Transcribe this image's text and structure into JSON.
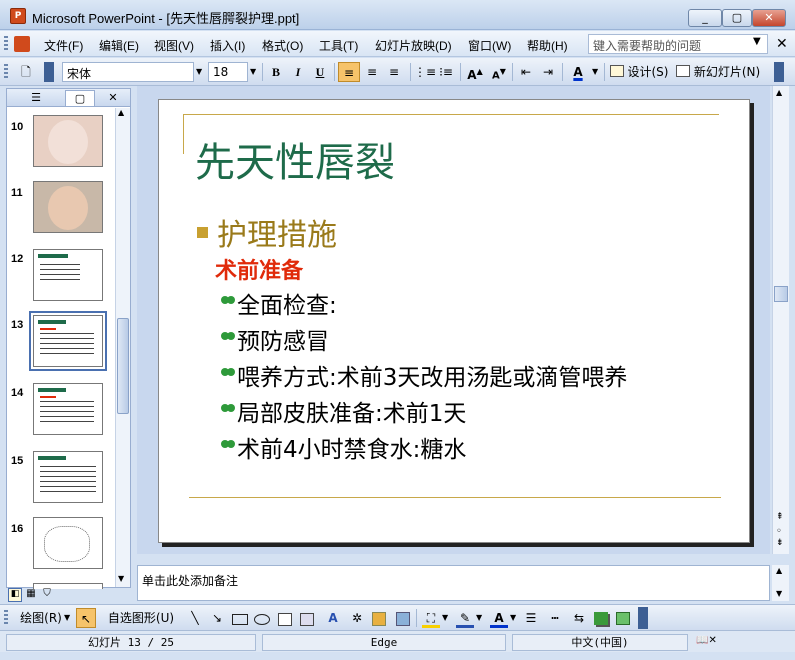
{
  "window": {
    "title": "Microsoft PowerPoint - [先天性唇腭裂护理.ppt]",
    "icon_label": "P"
  },
  "menu": {
    "items": [
      "文件(F)",
      "编辑(E)",
      "视图(V)",
      "插入(I)",
      "格式(O)",
      "工具(T)",
      "幻灯片放映(D)",
      "窗口(W)",
      "帮助(H)"
    ],
    "help_placeholder": "键入需要帮助的问题"
  },
  "toolbar": {
    "font_name": "宋体",
    "font_size": "18",
    "bold": "B",
    "italic": "I",
    "underline": "U",
    "design": "设计(S)",
    "new_slide": "新幻灯片(N)",
    "font_color_letter": "A"
  },
  "thumbnails": {
    "numbers": [
      "10",
      "11",
      "12",
      "13",
      "14",
      "15",
      "16"
    ],
    "selected": "13"
  },
  "slide": {
    "title": "先天性唇裂",
    "level1": "护理措施",
    "level2": "术前准备",
    "bullets": [
      "全面检查:",
      "预防感冒",
      "喂养方式:术前3天改用汤匙或滴管喂养",
      "局部皮肤准备:术前1天",
      "术前4小时禁食水:糖水"
    ]
  },
  "notes": {
    "placeholder": "单击此处添加备注"
  },
  "drawing_toolbar": {
    "draw": "绘图(R)",
    "autoshapes": "自选图形(U)"
  },
  "status": {
    "slide_info": "幻灯片 13 / 25",
    "design": "Edge",
    "language": "中文(中国)"
  },
  "colors": {
    "title": "#1e6b4a",
    "level1": "#9a7a1a",
    "level2": "#e02a0a",
    "accent_line": "#c8a84a",
    "bullet_green": "#2e9a3a"
  }
}
